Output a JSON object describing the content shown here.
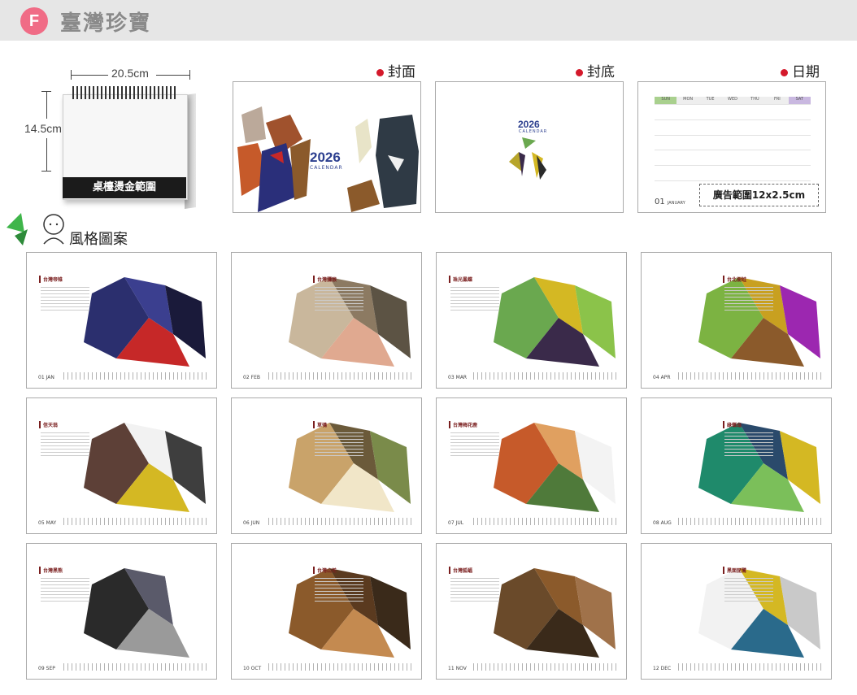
{
  "header": {
    "badge": "F",
    "title": "臺灣珍寶"
  },
  "product": {
    "width_label": "20.5cm",
    "height_label": "14.5cm",
    "bar_label": "桌檯燙金範圍"
  },
  "previews": [
    {
      "label": "封面",
      "year": "2026",
      "sub": "CALENDAR"
    },
    {
      "label": "封底",
      "year": "2026",
      "sub": "CALENDAR"
    },
    {
      "label": "日期",
      "ad_label": "廣告範圍12x2.5cm",
      "month": "01",
      "month_sub": "JANUARY",
      "days": [
        "SUN",
        "MON",
        "TUE",
        "WED",
        "THU",
        "FRI",
        "SAT"
      ]
    }
  ],
  "style_title": "風格圖案",
  "months": [
    {
      "num": "01",
      "abbr": "JAN",
      "name": "台灣帝雉"
    },
    {
      "num": "02",
      "abbr": "FEB",
      "name": "台灣獼猴"
    },
    {
      "num": "03",
      "abbr": "MAR",
      "name": "珠光鳳蝶"
    },
    {
      "num": "04",
      "abbr": "APR",
      "name": "台北樹蛙"
    },
    {
      "num": "05",
      "abbr": "MAY",
      "name": "信天翁"
    },
    {
      "num": "06",
      "abbr": "JUN",
      "name": "草鴞"
    },
    {
      "num": "07",
      "abbr": "JUL",
      "name": "台灣梅花鹿"
    },
    {
      "num": "08",
      "abbr": "AUG",
      "name": "綠蠵龜"
    },
    {
      "num": "09",
      "abbr": "SEP",
      "name": "台灣黑熊"
    },
    {
      "num": "10",
      "abbr": "OCT",
      "name": "台灣山羌"
    },
    {
      "num": "11",
      "abbr": "NOV",
      "name": "台灣狐蝠"
    },
    {
      "num": "12",
      "abbr": "DEC",
      "name": "黑面琵鷺"
    }
  ],
  "colors": {
    "header_bg": "#e6e6e6",
    "badge": "#f06c86",
    "dot": "#d4192b",
    "year": "#2c3f8f"
  }
}
